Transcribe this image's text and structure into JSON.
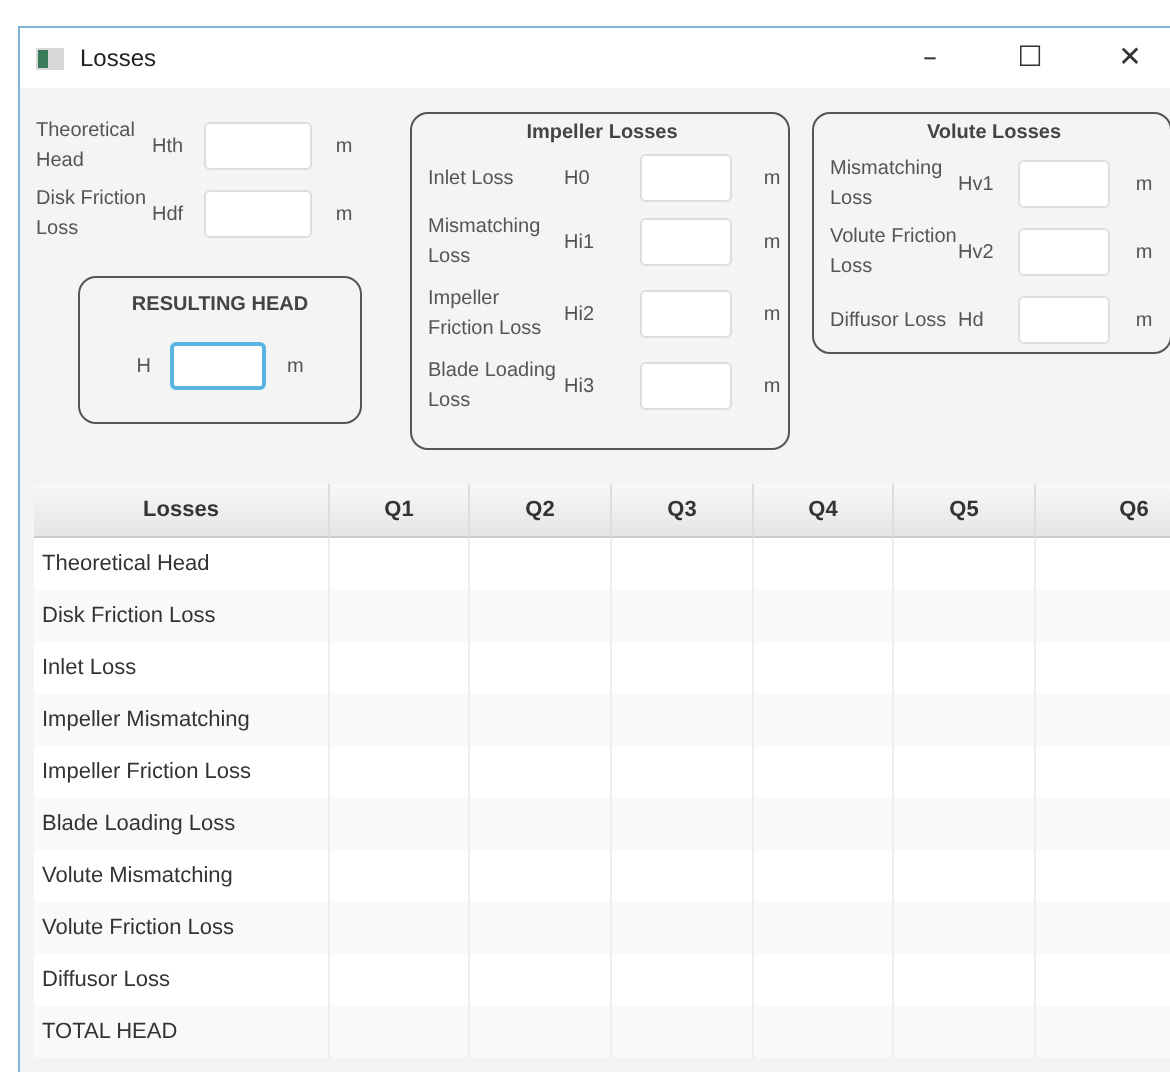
{
  "window": {
    "title": "Losses",
    "controls": [
      "–",
      "☐",
      "✕"
    ]
  },
  "head_fields": [
    {
      "label": "Theoretical Head",
      "symbol": "Hth",
      "unit": "m"
    },
    {
      "label": "Disk Friction Loss",
      "symbol": "Hdf",
      "unit": "m"
    }
  ],
  "resulting_head": {
    "title": "RESULTING HEAD",
    "symbol": "H",
    "unit": "m",
    "focused": true
  },
  "impeller_losses": {
    "title": "Impeller Losses",
    "fields": [
      {
        "label": "Inlet Loss",
        "symbol": "H0",
        "unit": "m"
      },
      {
        "label": "Mismatching Loss",
        "symbol": "Hi1",
        "unit": "m"
      },
      {
        "label": "Impeller Friction Loss",
        "symbol": "Hi2",
        "unit": "m"
      },
      {
        "label": "Blade Loading Loss",
        "symbol": "Hi3",
        "unit": "m"
      }
    ]
  },
  "volute_losses": {
    "title": "Volute Losses",
    "fields": [
      {
        "label": "Mismatching Loss",
        "symbol": "Hv1",
        "unit": "m"
      },
      {
        "label": "Volute Friction Loss",
        "symbol": "Hv2",
        "unit": "m"
      },
      {
        "label": "Diffusor Loss",
        "symbol": "Hd",
        "unit": "m"
      }
    ]
  },
  "table": {
    "columns": [
      "Losses",
      "Q1",
      "Q2",
      "Q3",
      "Q4",
      "Q5",
      "Q6"
    ],
    "rows": [
      "Theoretical Head",
      "Disk Friction Loss",
      "Inlet Loss",
      "Impeller Mismatching",
      "Impeller Friction Loss",
      "Blade Loading Loss",
      "Volute Mismatching",
      "Volute Friction Loss",
      "Diffusor Loss",
      "TOTAL HEAD"
    ]
  }
}
